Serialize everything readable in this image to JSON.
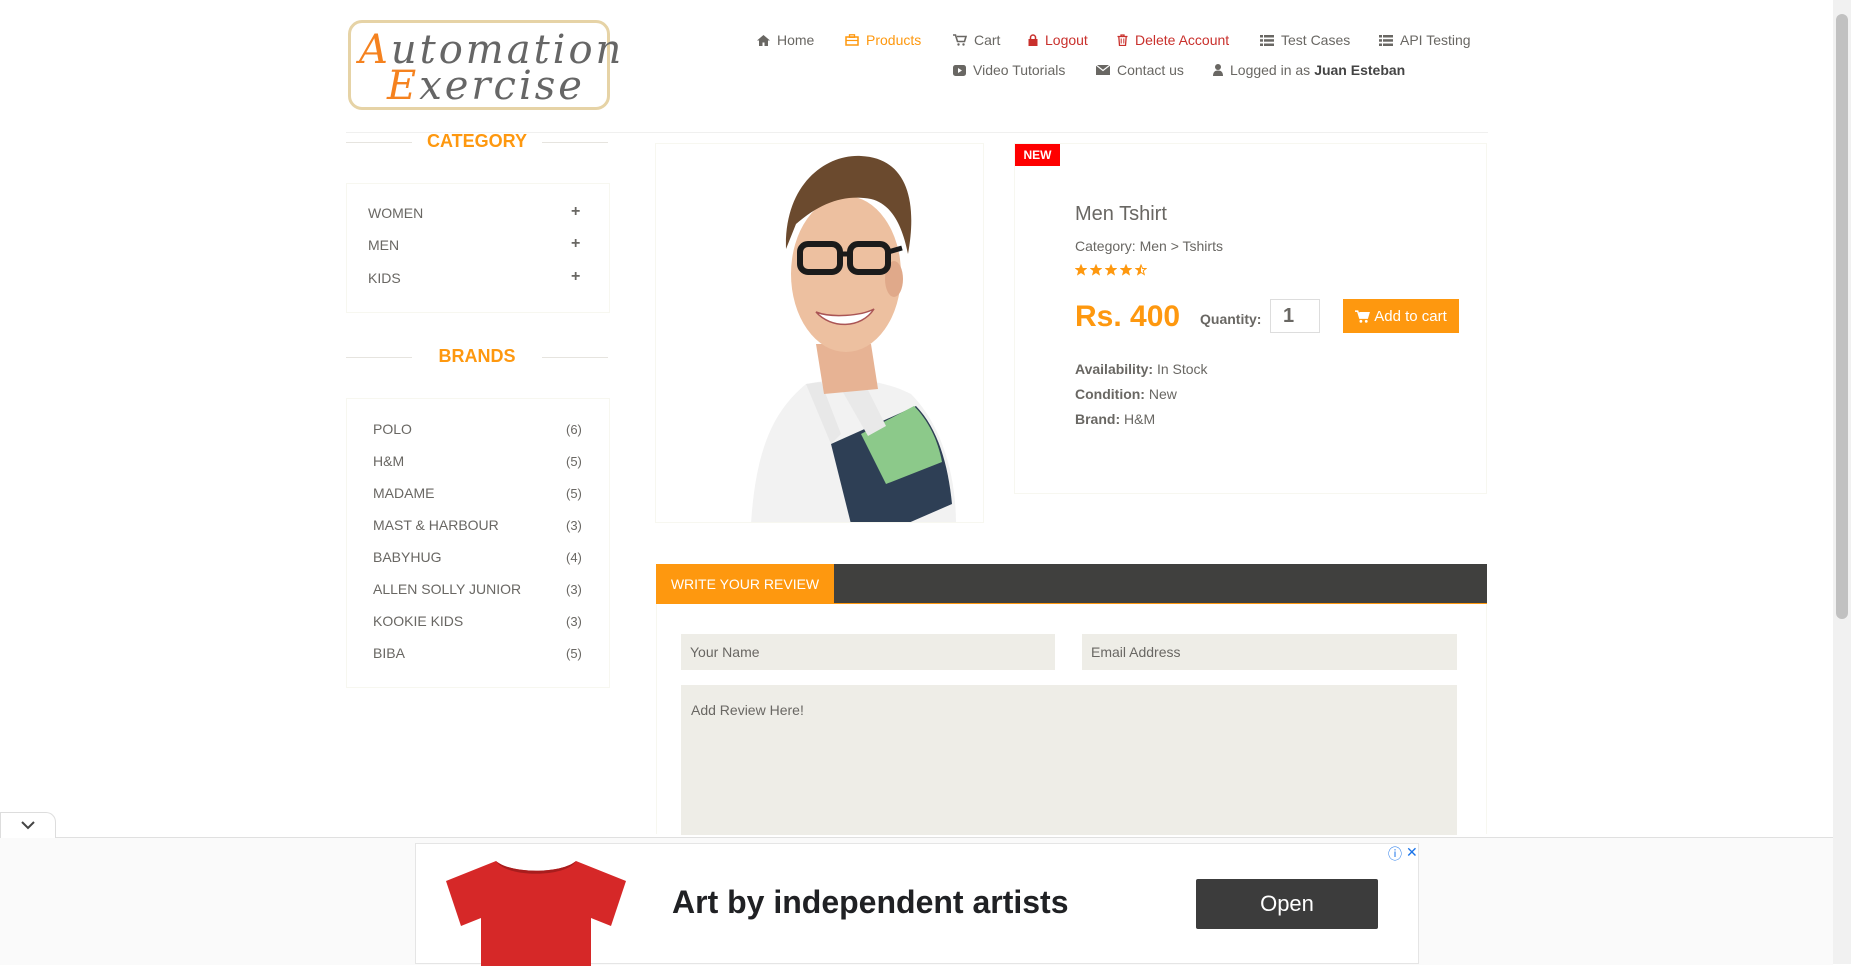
{
  "logo": {
    "line1_cap": "A",
    "line1": "utomation",
    "line2_cap": "E",
    "line2": "xercise"
  },
  "nav": {
    "home": "Home",
    "products": "Products",
    "cart": "Cart",
    "logout": "Logout",
    "delete_account": "Delete Account",
    "test_cases": "Test Cases",
    "api_testing": "API Testing",
    "video_tutorials": "Video Tutorials",
    "contact_us": "Contact us",
    "logged_in_prefix": "Logged in as",
    "logged_in_user": "Juan Esteban"
  },
  "sidebar": {
    "category_title": "CATEGORY",
    "categories": [
      {
        "label": "WOMEN",
        "icon": "+"
      },
      {
        "label": "MEN",
        "icon": "+"
      },
      {
        "label": "KIDS",
        "icon": "+"
      }
    ],
    "brands_title": "BRANDS",
    "brands": [
      {
        "name": "POLO",
        "count": "(6)"
      },
      {
        "name": "H&M",
        "count": "(5)"
      },
      {
        "name": "MADAME",
        "count": "(5)"
      },
      {
        "name": "MAST & HARBOUR",
        "count": "(3)"
      },
      {
        "name": "BABYHUG",
        "count": "(4)"
      },
      {
        "name": "ALLEN SOLLY JUNIOR",
        "count": "(3)"
      },
      {
        "name": "KOOKIE KIDS",
        "count": "(3)"
      },
      {
        "name": "BIBA",
        "count": "(5)"
      }
    ]
  },
  "product": {
    "badge": "NEW",
    "name": "Men Tshirt",
    "category": "Category: Men > Tshirts",
    "rating": 4.5,
    "price": "Rs. 400",
    "quantity_label": "Quantity:",
    "quantity_value": "1",
    "add_to_cart": "Add to cart",
    "availability_label": "Availability:",
    "availability_value": "In Stock",
    "condition_label": "Condition:",
    "condition_value": "New",
    "brand_label": "Brand:",
    "brand_value": "H&M"
  },
  "review": {
    "tab_label": "WRITE YOUR REVIEW",
    "name_placeholder": "Your Name",
    "email_placeholder": "Email Address",
    "review_placeholder": "Add Review Here!"
  },
  "ad": {
    "headline": "Art by independent artists",
    "cta": "Open",
    "info_icon": "ⓘ",
    "close_icon": "✕"
  },
  "colors": {
    "accent": "#fe980f",
    "text": "#696763",
    "danger": "#c9302c",
    "new_badge": "#fe0000",
    "review_bar": "#40403e"
  }
}
